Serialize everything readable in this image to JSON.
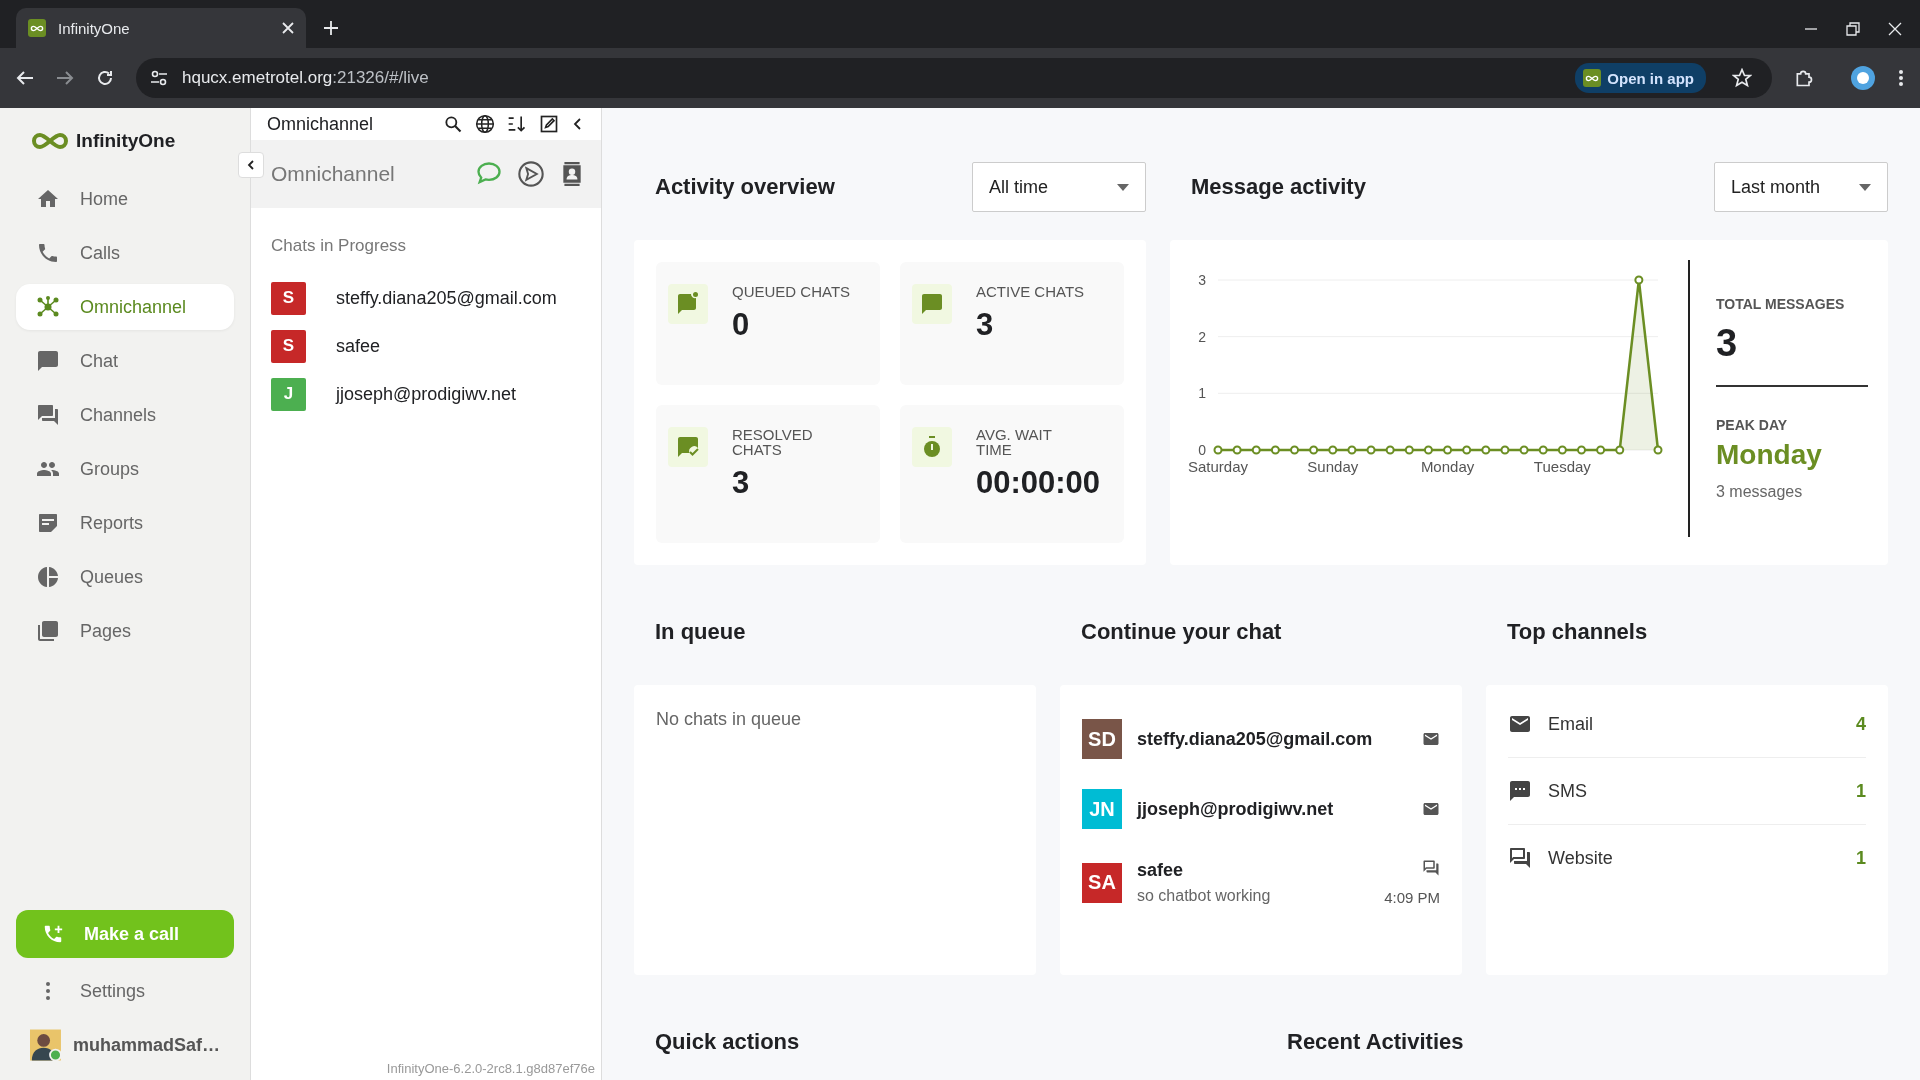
{
  "browser": {
    "tab_title": "InfinityOne",
    "url_host": "hqucx.emetrotel.org",
    "url_rest": ":21326/#/live",
    "open_in_app": "Open in app"
  },
  "nav": {
    "brand": "InfinityOne",
    "items": [
      {
        "label": "Home",
        "selected": false
      },
      {
        "label": "Calls",
        "selected": false
      },
      {
        "label": "Omnichannel",
        "selected": true
      },
      {
        "label": "Chat",
        "selected": false
      },
      {
        "label": "Channels",
        "selected": false
      },
      {
        "label": "Groups",
        "selected": false
      },
      {
        "label": "Reports",
        "selected": false
      },
      {
        "label": "Queues",
        "selected": false
      },
      {
        "label": "Pages",
        "selected": false
      }
    ],
    "make_call": "Make a call",
    "settings": "Settings",
    "user": "muhammadSaf…"
  },
  "panel": {
    "header_title": "Omnichannel",
    "sub_title": "Omnichannel",
    "section": "Chats in Progress",
    "chats": [
      {
        "initial": "S",
        "name": "steffy.diana205@gmail.com",
        "color": "#c62828"
      },
      {
        "initial": "S",
        "name": "safee",
        "color": "#c62828"
      },
      {
        "initial": "J",
        "name": "jjoseph@prodigiwv.net",
        "color": "#4caf50"
      }
    ],
    "version": "InfinityOne-6.2.0-2rc8.1.g8d87ef76e"
  },
  "activity_overview": {
    "title": "Activity overview",
    "filter": "All time",
    "stats": [
      {
        "label": "QUEUED CHATS",
        "value": "0"
      },
      {
        "label": "ACTIVE CHATS",
        "value": "3"
      },
      {
        "label": "RESOLVED CHATS",
        "value": "3"
      },
      {
        "label": "AVG. WAIT TIME",
        "value": "00:00:00"
      }
    ]
  },
  "message_activity": {
    "title": "Message activity",
    "filter": "Last month",
    "chart_data": {
      "type": "area",
      "categories": [
        "Saturday",
        null,
        null,
        null,
        null,
        null,
        "Sunday",
        null,
        null,
        null,
        null,
        null,
        "Monday",
        null,
        null,
        null,
        null,
        null,
        "Tuesday",
        null,
        null,
        null,
        null,
        null
      ],
      "series": [
        {
          "color": "#6b8e23",
          "values": [
            0,
            0,
            0,
            0,
            0,
            0,
            0,
            0,
            0,
            0,
            0,
            0,
            0,
            0,
            0,
            0,
            0,
            0,
            0,
            0,
            0,
            0,
            3,
            0
          ]
        }
      ],
      "ylim": [
        0,
        3
      ],
      "yticks": [
        0,
        1,
        2,
        3
      ]
    },
    "total_label": "TOTAL MESSAGES",
    "total": "3",
    "peak_label": "PEAK DAY",
    "peak_day": "Monday",
    "peak_count": "3 messages"
  },
  "in_queue": {
    "title": "In queue",
    "empty": "No chats in queue"
  },
  "continue_chat": {
    "title": "Continue your chat",
    "chats": [
      {
        "initials": "SD",
        "name": "steffy.diana205@gmail.com",
        "color": "#795548",
        "kind": "email"
      },
      {
        "initials": "JN",
        "name": "jjoseph@prodigiwv.net",
        "color": "#00bcd4",
        "kind": "email"
      },
      {
        "initials": "SA",
        "name": "safee",
        "color": "#c62828",
        "kind": "website",
        "preview": "so chatbot working",
        "time": "4:09 PM"
      }
    ]
  },
  "top_channels": {
    "title": "Top channels",
    "items": [
      {
        "kind": "email",
        "name": "Email",
        "count": "4"
      },
      {
        "kind": "sms",
        "name": "SMS",
        "count": "1"
      },
      {
        "kind": "website",
        "name": "Website",
        "count": "1"
      }
    ]
  },
  "quick_actions": {
    "title": "Quick actions"
  },
  "recent_activities": {
    "title": "Recent Activities"
  }
}
